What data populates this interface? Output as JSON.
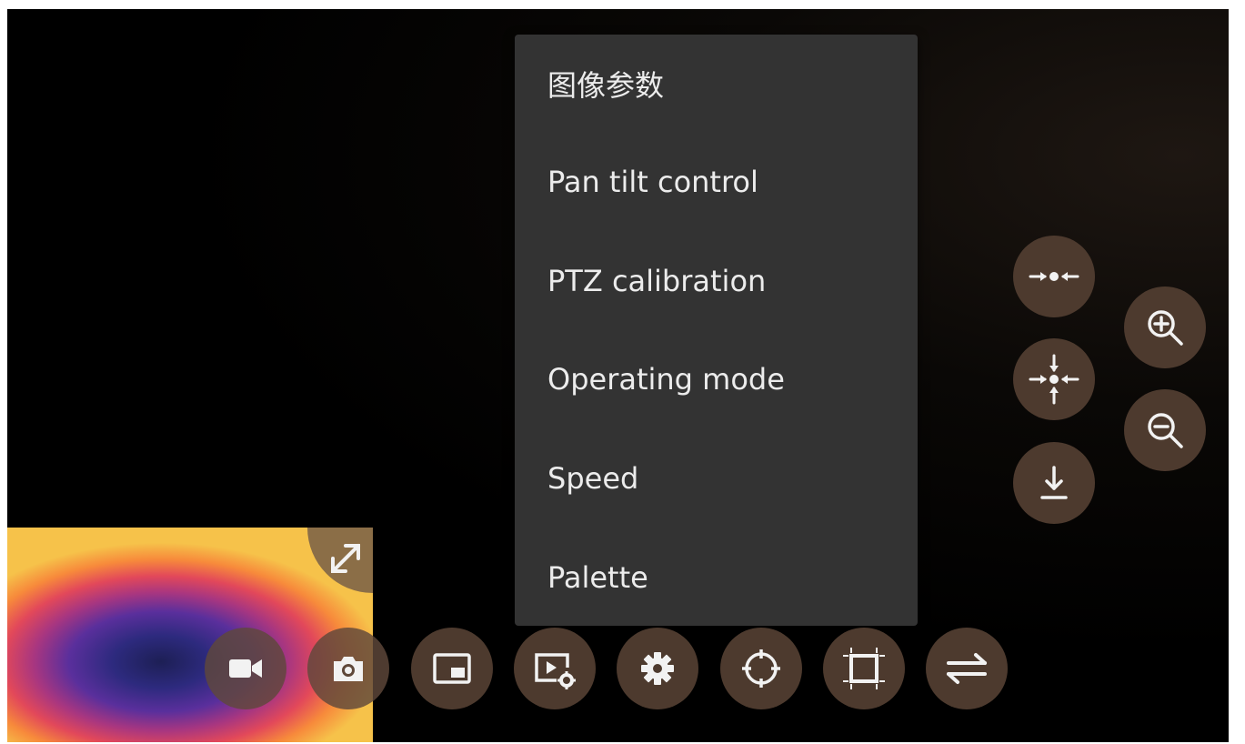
{
  "menu": {
    "items": [
      {
        "label": "图像参数"
      },
      {
        "label": "Pan tilt control"
      },
      {
        "label": "PTZ calibration"
      },
      {
        "label": "Operating mode"
      },
      {
        "label": "Speed"
      },
      {
        "label": "Palette"
      }
    ]
  },
  "thermal_preview": {
    "expand_icon": "expand-diagonal-icon"
  },
  "bottom_toolbar": {
    "buttons": [
      {
        "icon": "video-camera-icon"
      },
      {
        "icon": "camera-icon"
      },
      {
        "icon": "picture-in-picture-icon"
      },
      {
        "icon": "playback-settings-icon"
      },
      {
        "icon": "gear-icon"
      },
      {
        "icon": "crosshair-icon"
      },
      {
        "icon": "frame-select-icon"
      },
      {
        "icon": "swap-arrows-icon"
      }
    ]
  },
  "side_controls": {
    "buttons": [
      {
        "icon": "center-horizontal-icon"
      },
      {
        "icon": "center-all-icon"
      },
      {
        "icon": "download-icon"
      },
      {
        "icon": "zoom-in-icon"
      },
      {
        "icon": "zoom-out-icon"
      }
    ]
  },
  "colors": {
    "menu_bg": "#333333",
    "button_bg": "#4d3a2e",
    "icon": "#f2f2f2",
    "screen_bg": "#000000"
  }
}
